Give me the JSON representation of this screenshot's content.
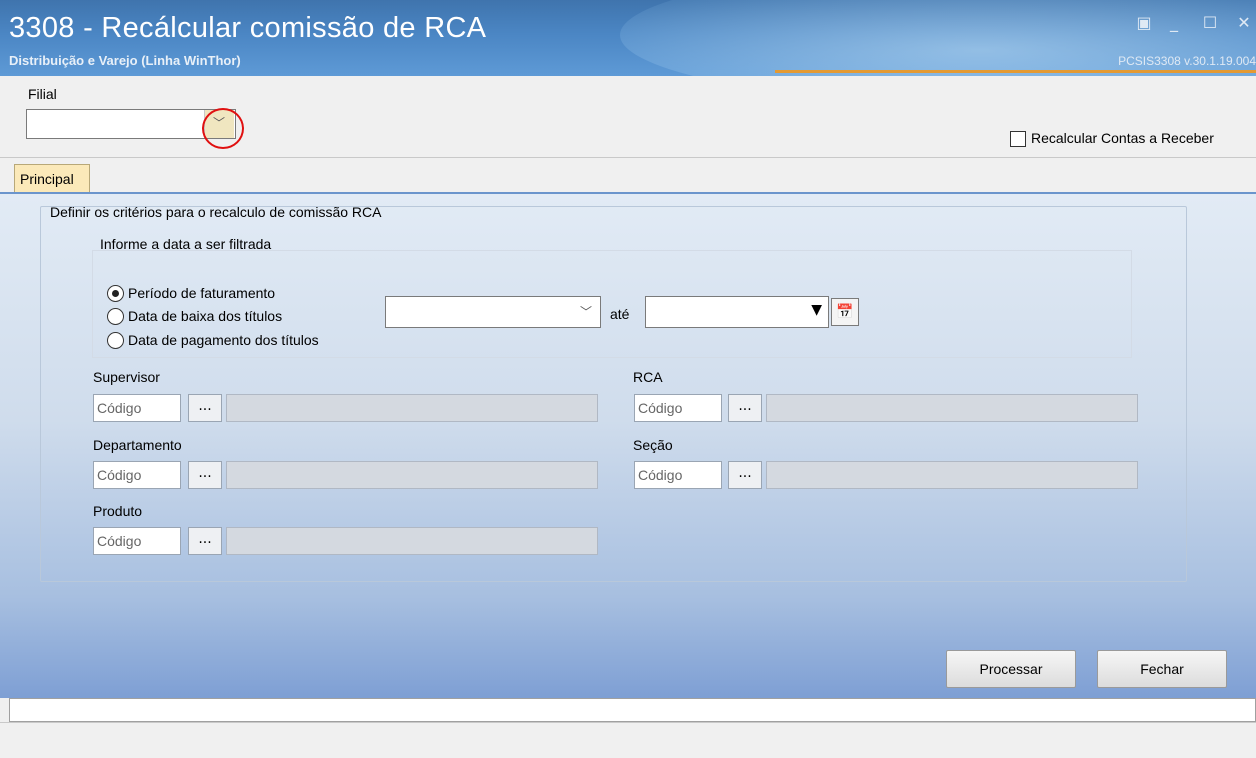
{
  "window": {
    "title": "3308 - Recálcular comissão de RCA",
    "subtitle": "Distribuição e Varejo (Linha WinThor)",
    "version": "PCSIS3308  v.30.1.19.004"
  },
  "top": {
    "filial_label": "Filial",
    "filial_value": "",
    "recalc_label": "Recalcular Contas a Receber",
    "recalc_checked": false
  },
  "tabs": [
    {
      "label": "Principal",
      "active": true
    }
  ],
  "criteria": {
    "title": "Definir os critérios para o recalculo de comissão RCA",
    "date_prompt": "Informe a data a ser filtrada",
    "radio_options": [
      {
        "label": "Período de faturamento",
        "selected": true
      },
      {
        "label": "Data de baixa dos títulos",
        "selected": false
      },
      {
        "label": "Data de pagamento dos títulos",
        "selected": false
      }
    ],
    "date_from": "",
    "until_label": "até",
    "date_to": ""
  },
  "filters": {
    "supervisor": {
      "label": "Supervisor",
      "placeholder": "Código",
      "button": "..."
    },
    "rca": {
      "label": "RCA",
      "placeholder": "Código",
      "button": "..."
    },
    "departamento": {
      "label": "Departamento",
      "placeholder": "Código",
      "button": "..."
    },
    "secao": {
      "label": "Seção",
      "placeholder": "Código",
      "button": "..."
    },
    "produto": {
      "label": "Produto",
      "placeholder": "Código",
      "button": "..."
    }
  },
  "buttons": {
    "processar": "Processar",
    "fechar": "Fechar"
  },
  "colors": {
    "title_bar": "#4b86c4",
    "accent_orange": "#e49a33",
    "highlight_circle": "#e01010",
    "tab_active": "#fbe9b9"
  }
}
